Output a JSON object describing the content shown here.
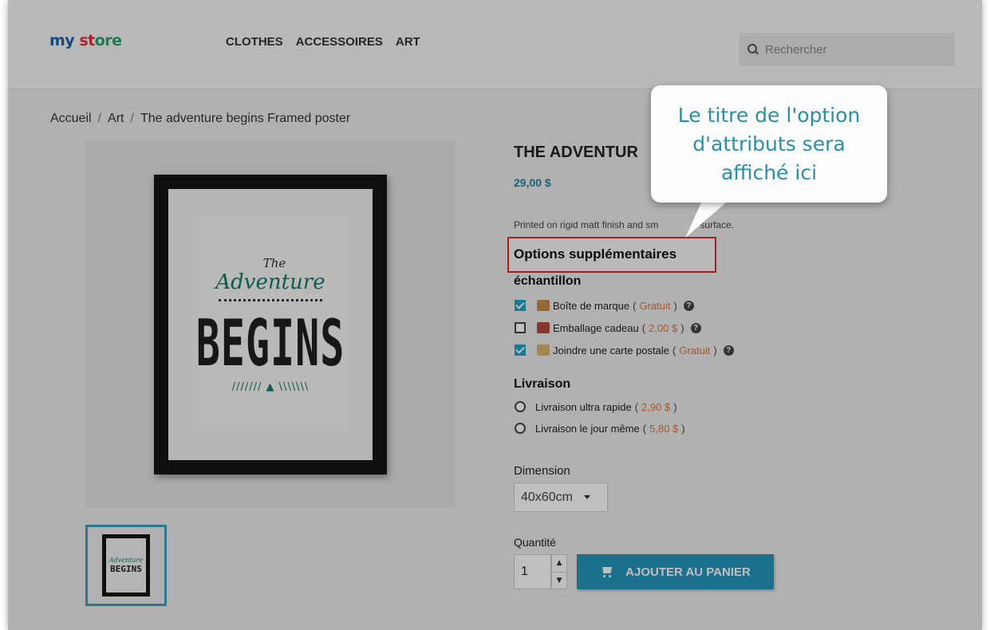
{
  "header": {
    "logo": [
      "my",
      " ",
      "st",
      "ore"
    ],
    "nav": [
      "CLOTHES",
      "ACCESSOIRES",
      "ART"
    ],
    "search_placeholder": "Rechercher"
  },
  "breadcrumb": [
    "Accueil",
    "Art",
    "The adventure begins Framed poster"
  ],
  "product": {
    "title": "THE ADVENTUR",
    "price": "29,00 $",
    "description": "Printed on rigid matt finish and sm",
    "description_tail": "surface.",
    "poster": {
      "the": "The",
      "adventure": "Adventure",
      "begins": "BEGINS",
      "tent": "/////// ▲ \\\\\\\\\\\\\\"
    },
    "thumb": {
      "adventure": "Adventure",
      "begins": "BEGINS"
    }
  },
  "options": {
    "title": "Options supplémentaires",
    "groups": [
      {
        "title": "échantillon",
        "items": [
          {
            "label": "Boîte de marque",
            "price": "Gratuit",
            "checked": true,
            "image_color": "#c98b4a"
          },
          {
            "label": "Emballage cadeau",
            "price": "2,00 $",
            "checked": false,
            "image_color": "#b5483d"
          },
          {
            "label": "Joindre une carte postale",
            "price": "Gratuit",
            "checked": true,
            "image_color": "#d8b26a"
          }
        ]
      },
      {
        "title": "Livraison",
        "items": [
          {
            "label": "Livraison ultra rapide",
            "price": "2,90 $"
          },
          {
            "label": "Livraison le jour même",
            "price": "5,80 $"
          }
        ]
      }
    ],
    "open_paren": "(",
    "close_paren": ")",
    "help_symbol": "?"
  },
  "dimension": {
    "label": "Dimension",
    "value": "40x60cm"
  },
  "quantity": {
    "label": "Quantité",
    "value": "1",
    "up": "▲",
    "down": "▼"
  },
  "cart_button": "AJOUTER AU PANIER",
  "callout": {
    "text": "Le titre de l'option d'attributs sera affiché ici"
  },
  "colors": {
    "accent": "#2496bd",
    "price_tag": "#e2723a",
    "highlight_border": "#e0262c",
    "callout_text": "#2a8fa6"
  }
}
